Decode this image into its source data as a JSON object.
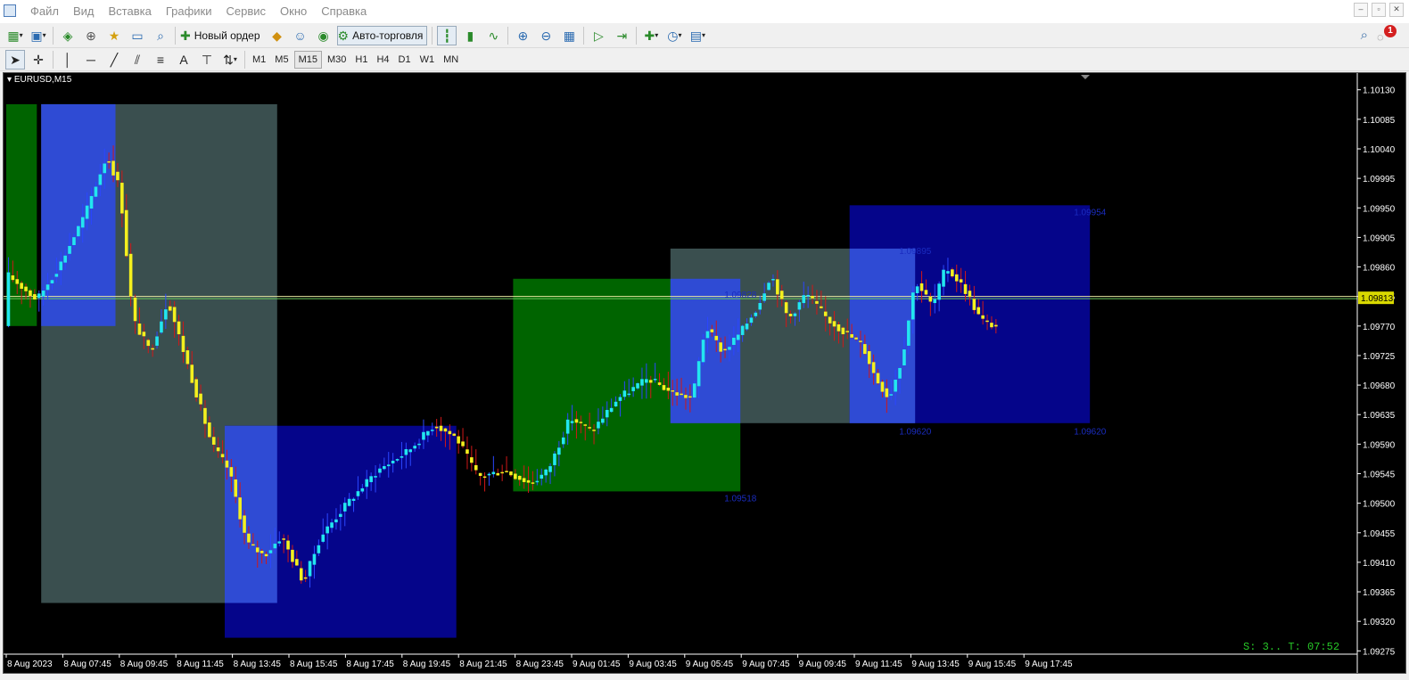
{
  "menu": [
    "Файл",
    "Вид",
    "Вставка",
    "Графики",
    "Сервис",
    "Окно",
    "Справка"
  ],
  "toolbar": {
    "new_order_label": "Новый ордер",
    "autotrade_label": "Авто-торговля"
  },
  "timeframes": [
    "M1",
    "M5",
    "M15",
    "M30",
    "H1",
    "H4",
    "D1",
    "W1",
    "MN"
  ],
  "active_timeframe": "M15",
  "notification_count": "1",
  "colors": {
    "background": "#000000",
    "bull_candle": "#22e6f0",
    "bear_candle": "#f4f01e",
    "bull_wick": "#2b47ff",
    "bear_wick": "#d01818",
    "price_line": "#c8e07a",
    "zone_green": "#006400",
    "zone_slate": "#3a4f4f",
    "zone_blue": "#05058a",
    "zone_overlap": "#2f4bd4",
    "zone_label": "#1a2cc0",
    "status_text": "#28c828"
  },
  "chart_data": {
    "type": "candlestick",
    "title": "EURUSD,M15",
    "current_price": "1.09813",
    "status_text": "S: 3.. T: 07:52",
    "ylim": [
      1.0927,
      1.1015
    ],
    "y_ticks": [
      "1.10130",
      "1.10085",
      "1.10040",
      "1.09995",
      "1.09950",
      "1.09905",
      "1.09860",
      "1.09815",
      "1.09770",
      "1.09725",
      "1.09680",
      "1.09635",
      "1.09590",
      "1.09545",
      "1.09500",
      "1.09455",
      "1.09410",
      "1.09365",
      "1.09320",
      "1.09275"
    ],
    "x_ticks": [
      "8 Aug 2023",
      "8 Aug 07:45",
      "8 Aug 09:45",
      "8 Aug 11:45",
      "8 Aug 13:45",
      "8 Aug 15:45",
      "8 Aug 17:45",
      "8 Aug 19:45",
      "8 Aug 21:45",
      "8 Aug 23:45",
      "9 Aug 01:45",
      "9 Aug 03:45",
      "9 Aug 05:45",
      "9 Aug 07:45",
      "9 Aug 09:45",
      "9 Aug 11:45",
      "9 Aug 13:45",
      "9 Aug 15:45",
      "9 Aug 17:45"
    ],
    "zone_labels": [
      {
        "text": "1.09828",
        "price": 1.09828,
        "bar": 168
      },
      {
        "text": "1.09518",
        "price": 1.09518,
        "bar": 168
      },
      {
        "text": "1.09954",
        "price": 1.09954,
        "bar": 248
      },
      {
        "text": "1.09895",
        "price": 1.09895,
        "bar": 208
      },
      {
        "text": "1.09620",
        "price": 1.0962,
        "bar": 208
      },
      {
        "text": "1.09620",
        "price": 1.0962,
        "bar": 248
      }
    ],
    "zones": [
      {
        "kind": "green",
        "bar_start": 0,
        "bar_end": 7,
        "high": 1.10108,
        "low": 1.0977
      },
      {
        "kind": "slate",
        "bar_start": 8,
        "bar_end": 62,
        "high": 1.10108,
        "low": 1.09348
      },
      {
        "kind": "overlap",
        "bar_start": 8,
        "bar_end": 25,
        "high": 1.10108,
        "low": 1.0977
      },
      {
        "kind": "blue",
        "bar_start": 50,
        "bar_end": 103,
        "high": 1.09618,
        "low": 1.09295
      },
      {
        "kind": "overlap",
        "bar_start": 50,
        "bar_end": 62,
        "high": 1.09618,
        "low": 1.09348
      },
      {
        "kind": "green",
        "bar_start": 116,
        "bar_end": 168,
        "high": 1.09842,
        "low": 1.09518
      },
      {
        "kind": "slate",
        "bar_start": 152,
        "bar_end": 208,
        "high": 1.09888,
        "low": 1.09622
      },
      {
        "kind": "overlap",
        "bar_start": 152,
        "bar_end": 168,
        "high": 1.09842,
        "low": 1.09622
      },
      {
        "kind": "blue",
        "bar_start": 193,
        "bar_end": 248,
        "high": 1.09954,
        "low": 1.09622
      },
      {
        "kind": "overlap",
        "bar_start": 193,
        "bar_end": 208,
        "high": 1.09888,
        "low": 1.09622
      }
    ],
    "anchors": [
      [
        0,
        1.0985
      ],
      [
        7,
        1.0981
      ],
      [
        12,
        1.0986
      ],
      [
        18,
        1.0994
      ],
      [
        23,
        1.1003
      ],
      [
        26,
        1.0998
      ],
      [
        29,
        1.0978
      ],
      [
        33,
        1.0973
      ],
      [
        37,
        1.0981
      ],
      [
        42,
        1.097
      ],
      [
        47,
        1.0959
      ],
      [
        51,
        1.0955
      ],
      [
        55,
        1.0944
      ],
      [
        59,
        1.0942
      ],
      [
        63,
        1.0945
      ],
      [
        68,
        1.0938
      ],
      [
        72,
        1.0945
      ],
      [
        78,
        1.095
      ],
      [
        85,
        1.0955
      ],
      [
        92,
        1.0958
      ],
      [
        98,
        1.0962
      ],
      [
        103,
        1.096
      ],
      [
        108,
        1.0954
      ],
      [
        114,
        1.0955
      ],
      [
        120,
        1.0953
      ],
      [
        124,
        1.0955
      ],
      [
        129,
        1.0963
      ],
      [
        134,
        1.0961
      ],
      [
        140,
        1.0966
      ],
      [
        147,
        1.0969
      ],
      [
        152,
        1.0967
      ],
      [
        157,
        1.0966
      ],
      [
        160,
        1.0977
      ],
      [
        164,
        1.0973
      ],
      [
        168,
        1.0976
      ],
      [
        172,
        1.098
      ],
      [
        175,
        1.0985
      ],
      [
        179,
        1.0978
      ],
      [
        183,
        1.0982
      ],
      [
        188,
        1.0978
      ],
      [
        192,
        1.0976
      ],
      [
        196,
        1.0974
      ],
      [
        199,
        1.0969
      ],
      [
        202,
        1.0966
      ],
      [
        205,
        1.0972
      ],
      [
        208,
        1.0984
      ],
      [
        212,
        1.098
      ],
      [
        215,
        1.0986
      ],
      [
        219,
        1.0983
      ],
      [
        223,
        1.0978
      ],
      [
        226,
        1.0977
      ]
    ]
  }
}
